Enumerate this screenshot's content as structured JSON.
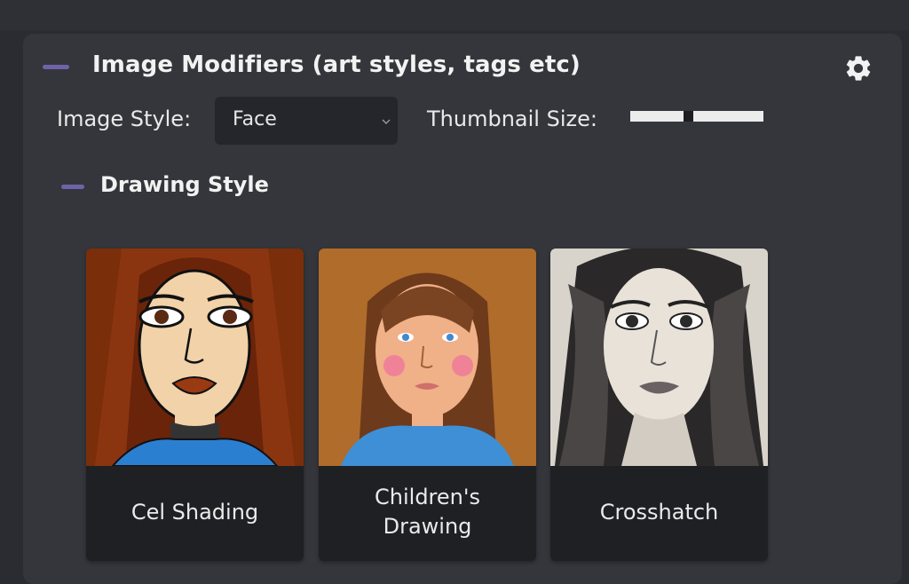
{
  "panel": {
    "title": "Image Modifiers (art styles, tags etc)",
    "settings_icon": "gear-icon",
    "image_style": {
      "label": "Image Style:",
      "selected": "Face"
    },
    "thumbnail_size": {
      "label": "Thumbnail Size:",
      "level": 0.43
    },
    "section": {
      "title": "Drawing Style",
      "items": [
        {
          "label": "Cel Shading"
        },
        {
          "label": "Children's\nDrawing"
        },
        {
          "label": "Crosshatch"
        }
      ]
    }
  },
  "colors": {
    "accent": "#6f63a8",
    "panel": "#35363c",
    "background": "#2b2c31"
  }
}
